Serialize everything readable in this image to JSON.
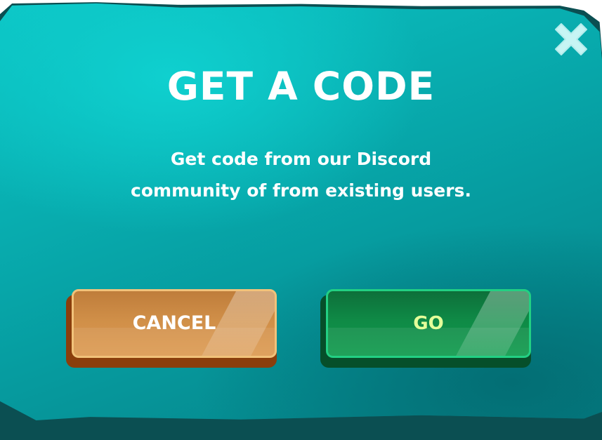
{
  "dialog": {
    "title": "GET A CODE",
    "message_line1": "Get code from our Discord",
    "message_line2": "community of from existing users.",
    "close_icon": "close-x-icon"
  },
  "buttons": {
    "cancel_label": "CANCEL",
    "go_label": "GO"
  },
  "colors": {
    "panel": "#07a6a9",
    "panel_rim": "#0b4f52",
    "close_icon": "#c6f5f4",
    "cancel_button": "#d08f48",
    "go_button": "#0f8a46",
    "go_label": "#e4ff9a"
  }
}
